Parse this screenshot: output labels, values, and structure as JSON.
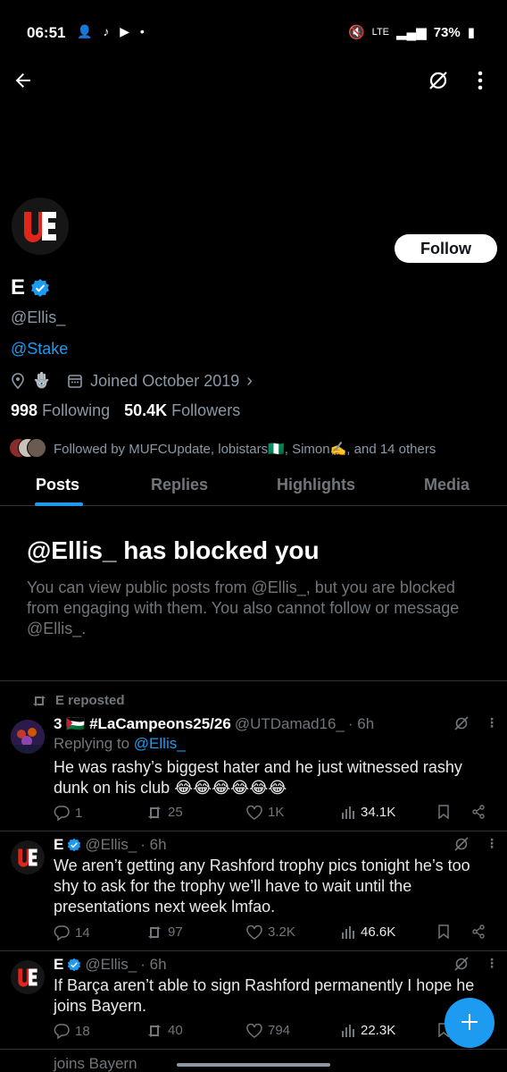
{
  "status": {
    "time": "06:51",
    "battery": "73%",
    "network": "LTE"
  },
  "profile": {
    "display_name": "E",
    "handle": "@Ellis_",
    "bio_link": "@Stake",
    "joined": "Joined October 2019",
    "following_count": "998",
    "following_label": "Following",
    "followers_count": "50.4K",
    "followers_label": "Followers",
    "followed_by": "Followed by MUFCUpdate, lobistars🇳🇬, Simon✍️, and 14 others",
    "follow_label": "Follow"
  },
  "tabs": [
    "Posts",
    "Replies",
    "Highlights",
    "Media"
  ],
  "blocked": {
    "title": "@Ellis_ has blocked you",
    "description": "You can view public posts from @Ellis_, but you are blocked from engaging with them. You also cannot follow or message @Ellis_."
  },
  "posts": [
    {
      "repost_label": "E reposted",
      "name": "3 🇵🇸 #LaCampeons25/26",
      "handle": "@UTDamad16_",
      "time": "· 6h",
      "replying_prefix": "Replying to",
      "replying_to": "@Ellis_",
      "text": "He was rashy’s biggest hater and he just witnessed rashy dunk on his club 😂😂😂😂😂😂",
      "replies": "1",
      "reposts": "25",
      "likes": "1K",
      "views": "34.1K"
    },
    {
      "name": "E",
      "handle": "@Ellis_",
      "time": "· 6h",
      "text": "We aren’t getting any Rashford trophy pics tonight he’s too shy to ask for the trophy we’ll have to wait until the presentations next week lmfao.",
      "replies": "14",
      "reposts": "97",
      "likes": "3.2K",
      "views": "46.6K"
    },
    {
      "name": "E",
      "handle": "@Ellis_",
      "time": "· 6h",
      "text": "If Barça aren’t able to sign Rashford permanently I hope he joins Bayern.",
      "replies": "18",
      "reposts": "40",
      "likes": "794",
      "views": "22.3K"
    }
  ],
  "peek_text": "joins Bayern",
  "colors": {
    "accent": "#1d9bf0",
    "background": "#000000",
    "muted": "#71767b"
  }
}
